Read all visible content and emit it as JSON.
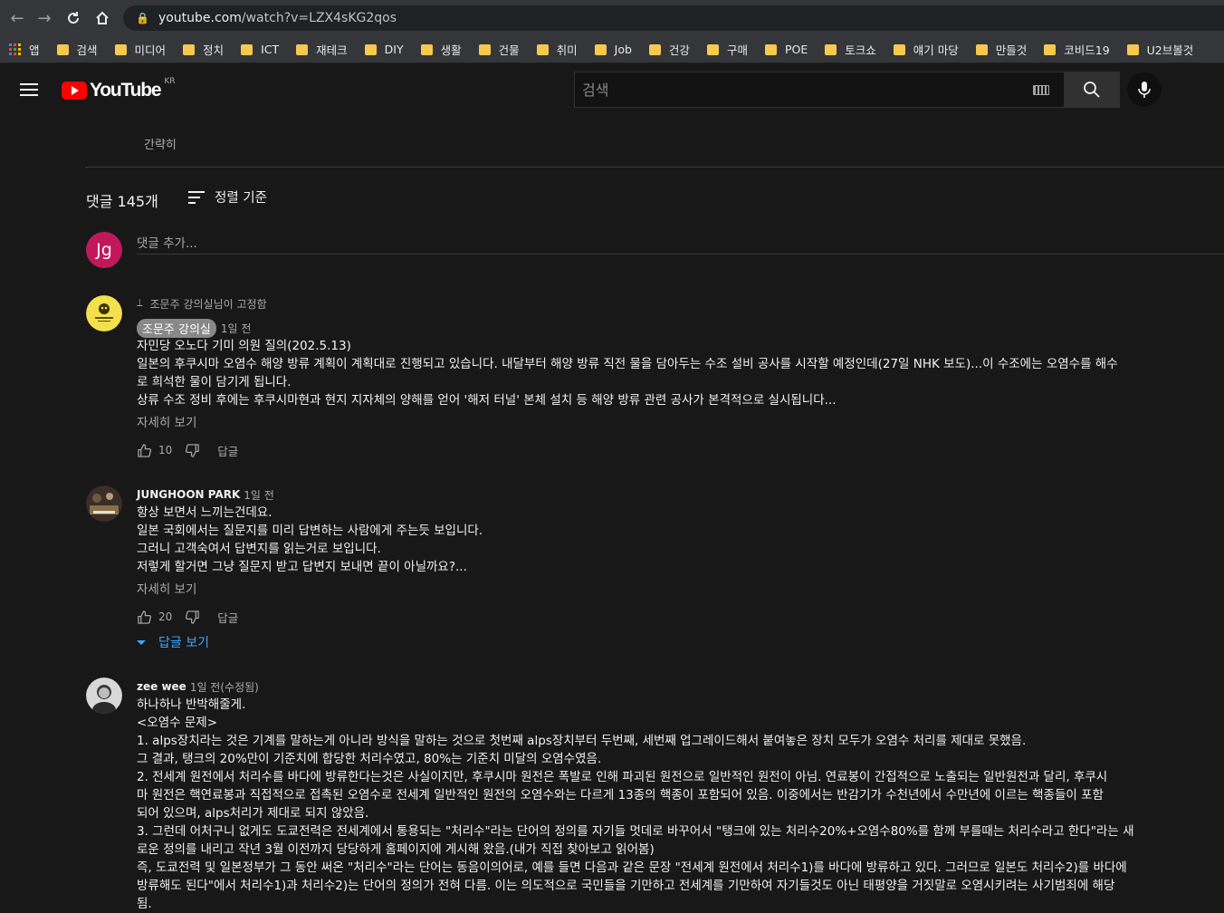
{
  "browser": {
    "url_host": "youtube.com",
    "url_path": "/watch?v=LZX4sKG2qos",
    "bookmarks": [
      {
        "label": "앱",
        "icon": "apps-icon"
      },
      {
        "label": "검색",
        "icon": "folder-icon"
      },
      {
        "label": "미디어",
        "icon": "folder-icon"
      },
      {
        "label": "정치",
        "icon": "folder-icon"
      },
      {
        "label": "ICT",
        "icon": "folder-icon"
      },
      {
        "label": "재테크",
        "icon": "folder-icon"
      },
      {
        "label": "DIY",
        "icon": "folder-icon"
      },
      {
        "label": "생활",
        "icon": "folder-icon"
      },
      {
        "label": "건물",
        "icon": "folder-icon"
      },
      {
        "label": "취미",
        "icon": "folder-icon"
      },
      {
        "label": "Job",
        "icon": "folder-icon"
      },
      {
        "label": "건강",
        "icon": "folder-icon"
      },
      {
        "label": "구매",
        "icon": "folder-icon"
      },
      {
        "label": "POE",
        "icon": "folder-icon"
      },
      {
        "label": "토크쇼",
        "icon": "folder-icon"
      },
      {
        "label": "얘기 마당",
        "icon": "folder-icon"
      },
      {
        "label": "만들것",
        "icon": "folder-icon"
      },
      {
        "label": "코비드19",
        "icon": "folder-icon"
      },
      {
        "label": "U2브볼것",
        "icon": "folder-icon"
      }
    ]
  },
  "header": {
    "logo_text": "YouTube",
    "region": "KR",
    "search_placeholder": "검색"
  },
  "comments_section": {
    "collapse_label": "간략히",
    "count_label": "댓글 145개",
    "sort_label": "정렬 기준",
    "add_avatar_initials": "Jg",
    "add_placeholder": "댓글 추가...",
    "comments": [
      {
        "pinned_label": "조문주 강의실님이 고정함",
        "author": "조문주 강의실",
        "time": "1일 전",
        "lines": [
          "자민당 오노다 기미 의원 질의(202.5.13)",
          "일본의 후쿠시마 오염수 해양 방류 계획이 계획대로 진행되고 있습니다. 내달부터 해양 방류 직전 물을 담아두는 수조 설비 공사를 시작할 예정인데(27일 NHK 보도)...이 수조에는 오염수를 해수",
          "로 희석한 물이 담기게 됩니다.",
          "상류 수조 정비 후에는 후쿠시마현과 현지 지자체의 양해를 얻어 '해저 터널' 본체 설치 등 해양 방류 관련 공사가 본격적으로 실시됩니다..."
        ],
        "more_label": "자세히 보기",
        "likes": "10",
        "reply_label": "답글"
      },
      {
        "author": "JUNGHOON PARK",
        "time": "1일 전",
        "lines": [
          "항상 보면서 느끼는건데요.",
          "일본 국회에서는 질문지를 미리 답변하는 사람에게 주는듯 보입니다.",
          "그러니 고객숙여서 답변지를 읽는거로 보입니다.",
          "저렇게 할거면 그냥 질문지 받고 답변지 보내면 끝이 아닐까요?..."
        ],
        "more_label": "자세히 보기",
        "likes": "20",
        "reply_label": "답글",
        "view_replies_label": "답글 보기"
      },
      {
        "author": "zee wee",
        "time": "1일 전(수정됨)",
        "lines": [
          "하나하나 반박해줄게.",
          "<오염수 문제>",
          "1. alps장치라는 것은 기계를 말하는게 아니라 방식을 말하는 것으로 첫번째 alps장치부터 두번째, 세번째 업그레이드해서 붙여놓은 장치 모두가 오염수 처리를 제대로 못했음.",
          "그 결과, 탱크의 20%만이 기준치에 합당한 처리수였고, 80%는 기준치 미달의 오염수였음.",
          "2. 전세계 원전에서 처리수를 바다에 방류한다는것은 사실이지만, 후쿠시마 원전은 폭발로 인해 파괴된 원전으로 일반적인 원전이 아님. 연료봉이 간접적으로 노출되는 일반원전과 달리, 후쿠시",
          "마 원전은 핵연료봉과 직접적으로 접촉된 오염수로 전세계 일반적인 원전의 오염수와는 다르게 13종의 핵종이 포함되어 있음. 이중에서는 반감기가 수천년에서 수만년에 이르는 핵종들이 포함",
          "되어 있으며, alps처리가 제대로 되지 않았음.",
          "3. 그런데 어처구니 없게도 도쿄전력은 전세계에서 통용되는 \"처리수\"라는 단어의 정의를 자기들 멋데로 바꾸어서 \"탱크에 있는 처리수20%+오염수80%를 함께 부를때는 처리수라고 한다\"라는 새",
          "로운 정의를 내리고 작년 3월 이전까지 당당하게 홈페이지에 게시해 왔음.(내가 직접 찾아보고 읽어봄)",
          "즉, 도쿄전력 및 일본정부가 그 동안 써온 \"처리수\"라는 단어는 동음이의어로, 예를 들면 다음과 같은 문장 \"전세계 원전에서 처리수1)를 바다에 방류하고 있다. 그러므로 일본도 처리수2)를 바다에",
          "방류해도 된다\"에서 처리수1)과 처리수2)는 단어의 정의가 전혀 다름. 이는 의도적으로 국민들을 기만하고 전세계를 기만하여 자기들것도 아닌 태평양을 거짓말로 오염시키려는 사기범죄에 해당",
          "됨."
        ]
      }
    ]
  },
  "colors": {
    "background": "#181818",
    "link_blue": "#3ea6ff",
    "youtube_red": "#ff0000",
    "folder_yellow": "#f6c94e",
    "add_avatar_bg": "#c2185b"
  }
}
